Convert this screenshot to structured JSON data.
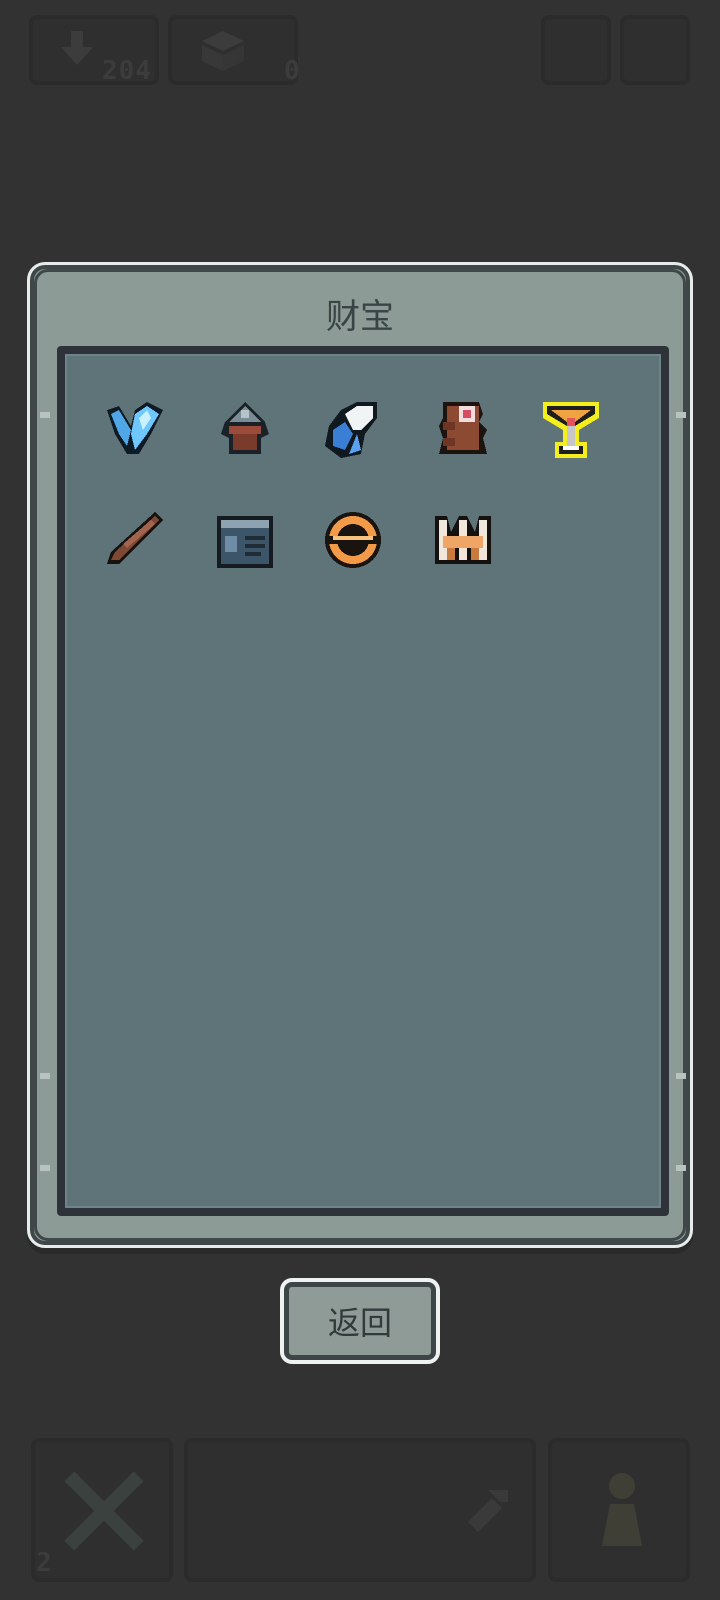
{
  "hud": {
    "downloads_count": "204",
    "boxes_count": "0",
    "bottom_left_count": "2"
  },
  "dialog": {
    "title": "财宝",
    "items": [
      {
        "name": "blue-crystal"
      },
      {
        "name": "spiked-helmet"
      },
      {
        "name": "blue-white-claw"
      },
      {
        "name": "brown-totem"
      },
      {
        "name": "golden-chalice"
      },
      {
        "name": "brown-stick"
      },
      {
        "name": "blue-box"
      },
      {
        "name": "orange-ring"
      },
      {
        "name": "crown-claw"
      }
    ]
  },
  "back_button": {
    "label": "返回"
  },
  "colors": {
    "background": "#323232",
    "dialog_frame": "#8c9b95",
    "grid_panel": "#5f7479",
    "selected_outline": "#f5ee1f"
  }
}
